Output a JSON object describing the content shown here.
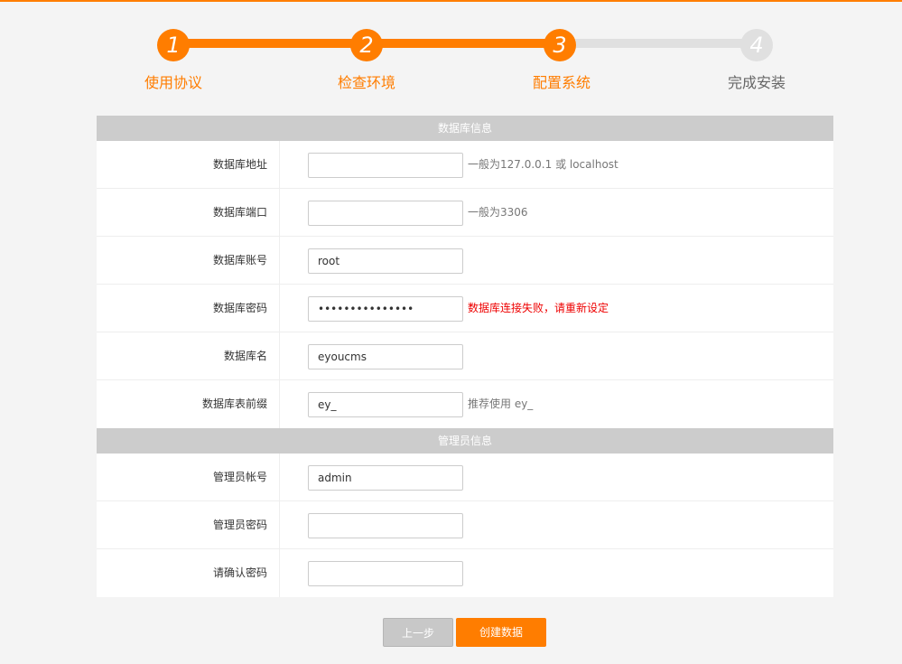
{
  "steps": [
    {
      "number": "1",
      "label": "使用协议",
      "state": "active"
    },
    {
      "number": "2",
      "label": "检查环境",
      "state": "active"
    },
    {
      "number": "3",
      "label": "配置系统",
      "state": "active"
    },
    {
      "number": "4",
      "label": "完成安装",
      "state": "inactive"
    }
  ],
  "database_section": {
    "title": "数据库信息",
    "fields": [
      {
        "label": "数据库地址",
        "value": "",
        "hint": "一般为127.0.0.1 或 localhost"
      },
      {
        "label": "数据库端口",
        "value": "",
        "hint": "一般为3306"
      },
      {
        "label": "数据库账号",
        "value": "root",
        "hint": ""
      },
      {
        "label": "数据库密码",
        "value": "•••••••••••••••",
        "hint": "数据库连接失败，请重新设定"
      },
      {
        "label": "数据库名",
        "value": "eyoucms",
        "hint": ""
      },
      {
        "label": "数据库表前缀",
        "value": "ey_",
        "hint": "推荐使用 ey_"
      }
    ]
  },
  "admin_section": {
    "title": "管理员信息",
    "fields": [
      {
        "label": "管理员帐号",
        "value": "admin"
      },
      {
        "label": "管理员密码",
        "value": ""
      },
      {
        "label": "请确认密码",
        "value": ""
      }
    ]
  },
  "buttons": {
    "prev_label": "上一步",
    "next_label": "创建数据"
  },
  "colors": {
    "accent": "#ff7d00",
    "inactive": "#e0e0e0",
    "error": "#ee0000",
    "header_bg": "#cccccc"
  }
}
